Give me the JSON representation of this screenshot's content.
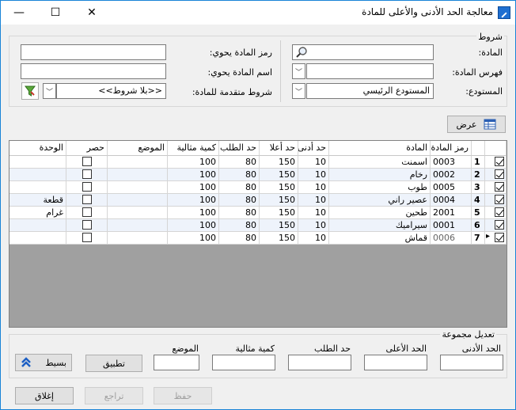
{
  "window": {
    "title": "معالجة الحد الأدنى والأعلى للمادة",
    "minimize_glyph": "—",
    "maximize_glyph": "☐",
    "close_glyph": "✕"
  },
  "conditions": {
    "group_label": "شروط",
    "material_label": "المادة:",
    "material_value": "",
    "index_label": "فهرس المادة:",
    "index_value": "",
    "warehouse_label": "المستودع:",
    "warehouse_value": "المستودع الرئيسي",
    "code_contains_label": "رمز المادة يحوي:",
    "code_contains_value": "",
    "name_contains_label": "اسم المادة يحوي:",
    "name_contains_value": "",
    "advanced_label": "شروط متقدمة للمادة:",
    "advanced_value": "<<بلا شروط>>"
  },
  "show_button_label": "عرض",
  "grid": {
    "columns": [
      "رمز المادة",
      "المادة",
      "حد أدنى",
      "حد أعلا",
      "حد الطلب",
      "كمية مثالية",
      "الموضع",
      "حصر",
      "الوحدة"
    ],
    "rows": [
      {
        "n": "1",
        "code": "0003",
        "name": "اسمنت",
        "min": "10",
        "max": "150",
        "order": "80",
        "ideal": "100",
        "pos": "",
        "limit": false,
        "unit": "",
        "checked": true
      },
      {
        "n": "2",
        "code": "0002",
        "name": "رخام",
        "min": "10",
        "max": "150",
        "order": "80",
        "ideal": "100",
        "pos": "",
        "limit": false,
        "unit": "",
        "checked": true
      },
      {
        "n": "3",
        "code": "0005",
        "name": "طوب",
        "min": "10",
        "max": "150",
        "order": "80",
        "ideal": "100",
        "pos": "",
        "limit": false,
        "unit": "",
        "checked": true
      },
      {
        "n": "4",
        "code": "0004",
        "name": "عصير راني",
        "min": "10",
        "max": "150",
        "order": "80",
        "ideal": "100",
        "pos": "",
        "limit": false,
        "unit": "قطعة",
        "checked": true
      },
      {
        "n": "5",
        "code": "2001",
        "name": "طحين",
        "min": "10",
        "max": "150",
        "order": "80",
        "ideal": "100",
        "pos": "",
        "limit": false,
        "unit": "غرام",
        "checked": true
      },
      {
        "n": "6",
        "code": "0001",
        "name": "سيراميك",
        "min": "10",
        "max": "150",
        "order": "80",
        "ideal": "100",
        "pos": "",
        "limit": false,
        "unit": "",
        "checked": true
      },
      {
        "n": "7",
        "code": "0006",
        "name": "قماش",
        "min": "10",
        "max": "150",
        "order": "80",
        "ideal": "100",
        "pos": "",
        "limit": false,
        "unit": "",
        "checked": true
      }
    ]
  },
  "group_edit": {
    "group_label": "تعديل مجموعة",
    "min_label": "الحد الأدنى",
    "max_label": "الحد الأعلى",
    "order_label": "حد الطلب",
    "ideal_label": "كمية مثالية",
    "pos_label": "الموضع",
    "apply_label": "تطبيق",
    "simple_label": "بسيط"
  },
  "footer": {
    "save_label": "حفظ",
    "undo_label": "تراجع",
    "close_label": "إغلاق"
  }
}
